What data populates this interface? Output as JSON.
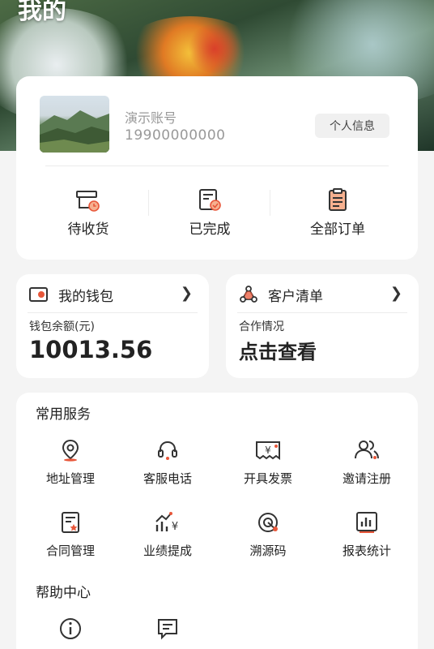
{
  "page": {
    "title": "我的"
  },
  "profile": {
    "account_name": "演示账号",
    "phone": "19900000000",
    "info_button": "个人信息"
  },
  "orders": [
    {
      "label": "待收货",
      "icon": "pending-delivery-icon"
    },
    {
      "label": "已完成",
      "icon": "completed-icon"
    },
    {
      "label": "全部订单",
      "icon": "all-orders-icon"
    }
  ],
  "wallet": {
    "title": "我的钱包",
    "balance_label": "钱包余额(元)",
    "balance": "10013.56",
    "icon": "wallet-icon"
  },
  "customers": {
    "title": "客户清单",
    "sub_label": "合作情况",
    "action": "点击查看",
    "icon": "customer-network-icon"
  },
  "common_services": {
    "title": "常用服务",
    "items": [
      {
        "label": "地址管理",
        "icon": "location-icon"
      },
      {
        "label": "客服电话",
        "icon": "headset-icon"
      },
      {
        "label": "开具发票",
        "icon": "invoice-icon"
      },
      {
        "label": "邀请注册",
        "icon": "invite-users-icon"
      },
      {
        "label": "合同管理",
        "icon": "contract-icon"
      },
      {
        "label": "业绩提成",
        "icon": "commission-chart-icon"
      },
      {
        "label": "溯源码",
        "icon": "trace-code-icon"
      },
      {
        "label": "报表统计",
        "icon": "report-chart-icon"
      }
    ]
  },
  "help_center": {
    "title": "帮助中心",
    "items": [
      {
        "icon": "info-icon"
      },
      {
        "icon": "message-icon"
      }
    ]
  },
  "colors": {
    "accent": "#e8573a",
    "background": "#f4f4f4",
    "card": "#ffffff"
  }
}
